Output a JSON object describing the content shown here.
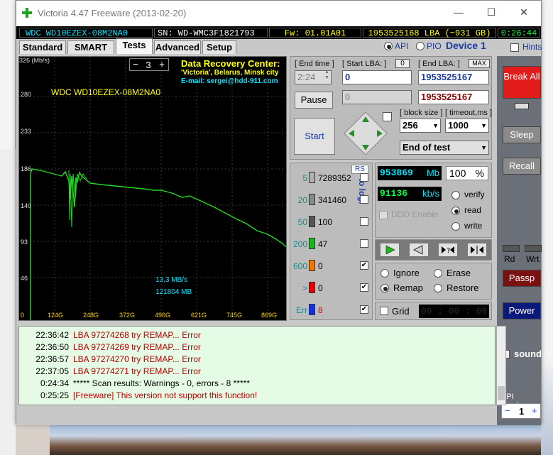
{
  "window": {
    "title": "Victoria 4.47 Freeware (2013-02-20)",
    "minimize": "—",
    "maximize": "☐",
    "close": "✕"
  },
  "infobar": {
    "model": "WDC WD10EZEX-08M2NA0",
    "serial": "SN: WD-WMC3F1821793",
    "firmware": "Fw: 01.01A01",
    "lba": "1953525168 LBA (~931 GB)",
    "time": "0:26:44"
  },
  "tabs": [
    "Standard",
    "SMART",
    "Tests",
    "Advanced",
    "Setup"
  ],
  "mode": {
    "api": "API",
    "pio": "PIO",
    "device": "Device 1",
    "hints": "Hints"
  },
  "graph": {
    "unit": "326 (Mb/s)",
    "y_ticks": [
      "280",
      "233",
      "186",
      "140",
      "93",
      "46",
      "0"
    ],
    "x_ticks": [
      "124G",
      "248G",
      "372G",
      "496G",
      "621G",
      "745G",
      "869G"
    ],
    "drive": "WDC WD10EZEX-08M2NA0",
    "speed": "13,3 MB/s",
    "done": "121804 MB",
    "counter_minus": "−",
    "counter_value": "3",
    "counter_plus": "+",
    "drc_title": "Data Recovery Center:",
    "drc_line1": "'Victoria', Belarus, Minsk city",
    "drc_line2": "E-mail: sergei@hdd-911.com"
  },
  "controls": {
    "end_time_label": "[ End time ]",
    "end_time": "2:24",
    "start_lba_label": "[ Start LBA: ]",
    "start_lba": "0",
    "start_lba_small": "0",
    "end_lba_label": "[ End LBA: ]",
    "max": "MAX",
    "end_lba": "1953525167",
    "cur_lba": "1953525167",
    "pos_field": "0",
    "pause": "Pause",
    "start": "Start",
    "block_size_label": "[ block size ]",
    "block_size": "256",
    "timeout_label": "[ timeout,ms ]",
    "timeout": "1000",
    "end_action": "End of test"
  },
  "stats": {
    "rs": "RS",
    "to_log": "to log:",
    "rows": [
      {
        "label": "5",
        "count": "7289352",
        "color": "#b0b0b0",
        "checked": false
      },
      {
        "label": "20",
        "count": "341460",
        "color": "#8a8a8a",
        "checked": false
      },
      {
        "label": "50",
        "count": "100",
        "color": "#555555",
        "checked": false
      },
      {
        "label": "200",
        "count": "47",
        "color": "#1fb51f",
        "checked": false
      },
      {
        "label": "600",
        "count": "0",
        "color": "#f07800",
        "checked": true
      },
      {
        "label": ">",
        "count": "0",
        "color": "#e00000",
        "checked": true
      },
      {
        "label": "Err",
        "count": "8",
        "color": "#1030e0",
        "checked": true
      }
    ]
  },
  "progress": {
    "mb": "953869",
    "mb_unit": "Mb",
    "percent": "100",
    "percent_unit": "%",
    "speed": "91136",
    "speed_unit": "kb/s",
    "ddd": "DDD Enable",
    "verify": "verify",
    "read": "read",
    "write": "write"
  },
  "actions": {
    "ignore": "Ignore",
    "erase": "Erase",
    "remap": "Remap",
    "restore": "Restore",
    "grid": "Grid",
    "grid_time": "00 : 00 : 00"
  },
  "side": {
    "break_all": "Break All",
    "sleep": "Sleep",
    "recall": "Recall",
    "rd": "Rd",
    "wrt": "Wrt",
    "passp": "Passp",
    "power": "Power",
    "sound": "sound",
    "api_number": "API number",
    "api_value": "1"
  },
  "log": [
    {
      "time": "22:36:42",
      "text": "LBA 97274268 try REMAP... Error",
      "color": "#c00000"
    },
    {
      "time": "22:36:50",
      "text": "LBA 97274269 try REMAP... Error",
      "color": "#c00000"
    },
    {
      "time": "22:36:57",
      "text": "LBA 97274270 try REMAP... Error",
      "color": "#c00000"
    },
    {
      "time": "22:37:05",
      "text": "LBA 97274271 try REMAP... Error",
      "color": "#c00000"
    },
    {
      "time": "0:24:34",
      "text": "***** Scan results: Warnings - 0, errors - 8 *****",
      "color": "#000000"
    },
    {
      "time": "0:25:25",
      "text": "[Freeware] This version not support this function!",
      "color": "#c00000"
    }
  ]
}
